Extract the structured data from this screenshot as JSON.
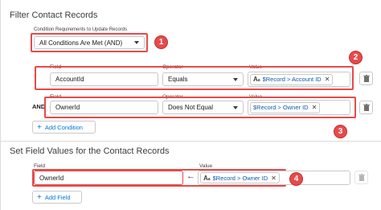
{
  "filter": {
    "title": "Filter Contact Records",
    "condition_label": "Condition Requirements to Update Records",
    "condition_value": "All Conditions Are Met (AND)",
    "rows": [
      {
        "field_label": "Field",
        "operator_label": "Operator",
        "value_label": "Value",
        "field": "AccountId",
        "operator": "Equals",
        "value": "$Record > Account ID"
      },
      {
        "field_label": "Field",
        "operator_label": "Operator",
        "value_label": "Value",
        "prefix": "AND",
        "field": "OwnerId",
        "operator": "Does Not Equal",
        "value": "$Record > Owner ID"
      }
    ],
    "add_condition_label": "Add Condition"
  },
  "set_values": {
    "title": "Set Field Values for the Contact Records",
    "field_label": "Field",
    "value_label": "Value",
    "field": "OwnerId",
    "value": "$Record > Owner ID",
    "add_field_label": "Add Field"
  },
  "badges": [
    "1",
    "2",
    "3",
    "4"
  ],
  "icons": {
    "resource": "resource-text-icon",
    "remove": "close-icon",
    "delete": "trash-icon",
    "arrow": "arrow-left-icon",
    "add": "plus-icon"
  },
  "colors": {
    "annotation": "#e84a4a",
    "link": "#0176d3",
    "pill_text": "#0b5cab"
  }
}
